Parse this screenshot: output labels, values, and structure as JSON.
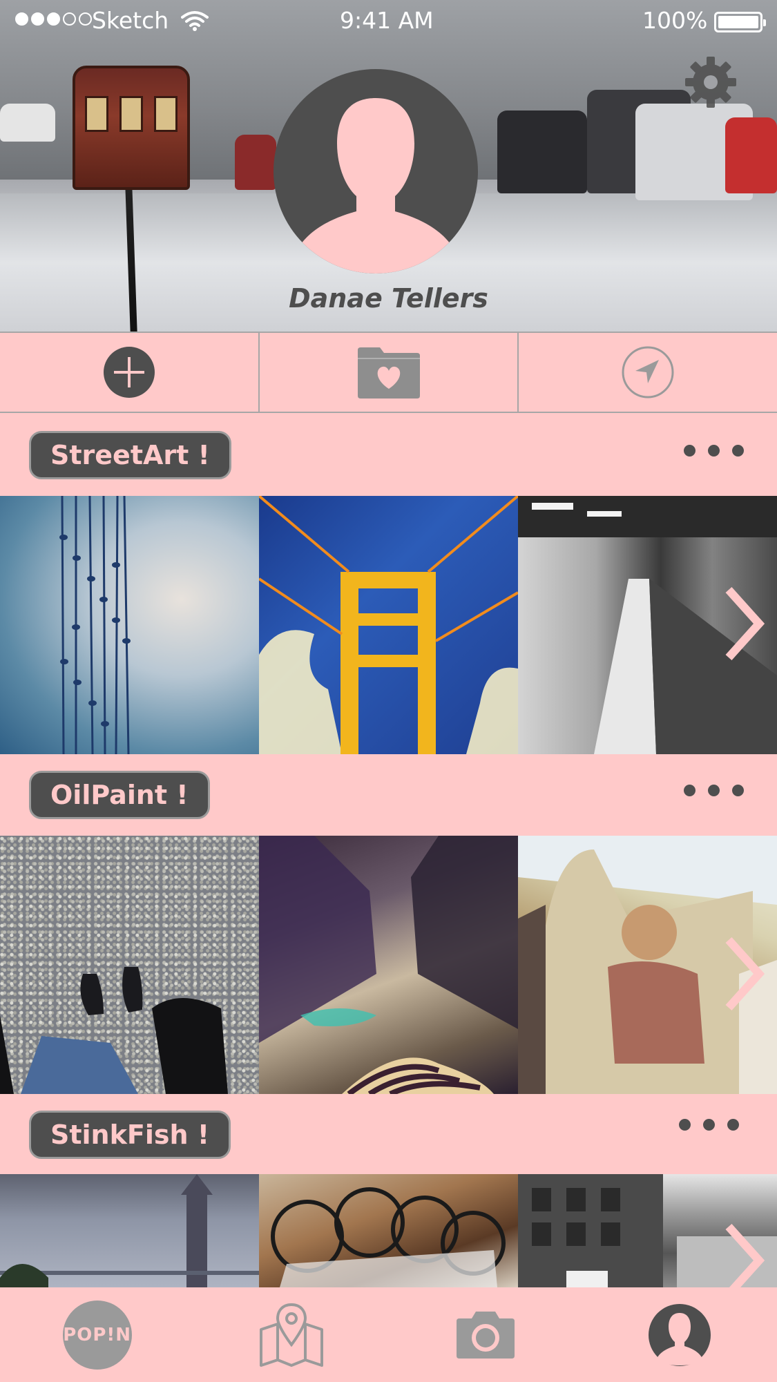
{
  "status_bar": {
    "carrier": "Sketch",
    "time": "9:41 AM",
    "battery_percent": "100%",
    "signal_bars_filled": 3,
    "signal_bars_total": 5
  },
  "profile": {
    "name": "Danae Tellers"
  },
  "actions": [
    {
      "name": "add",
      "icon": "plus-circle-icon"
    },
    {
      "name": "favorites",
      "icon": "heart-folder-icon"
    },
    {
      "name": "location",
      "icon": "navigation-arrow-icon"
    }
  ],
  "sections": [
    {
      "tag": "StreetArt  !",
      "photos": [
        "hanging-shoes-sky",
        "golden-gate-tower",
        "subway-tunnel"
      ]
    },
    {
      "tag": "OilPaint  !",
      "photos": [
        "feet-on-gravel",
        "painted-alley",
        "building-mural"
      ]
    },
    {
      "tag": "StinkFish  !",
      "photos": [
        "ferry-building-rain",
        "bike-rack",
        "city-street"
      ]
    }
  ],
  "tab_bar": {
    "logo_label": "POP!N",
    "tabs": [
      "logo",
      "map-icon",
      "camera-icon",
      "profile-icon"
    ],
    "active": "profile"
  },
  "colors": {
    "background": "#ffc9c9",
    "dark": "#4e4e4e",
    "muted": "#9a9a9a",
    "accent_pink": "#ffc9c9"
  }
}
